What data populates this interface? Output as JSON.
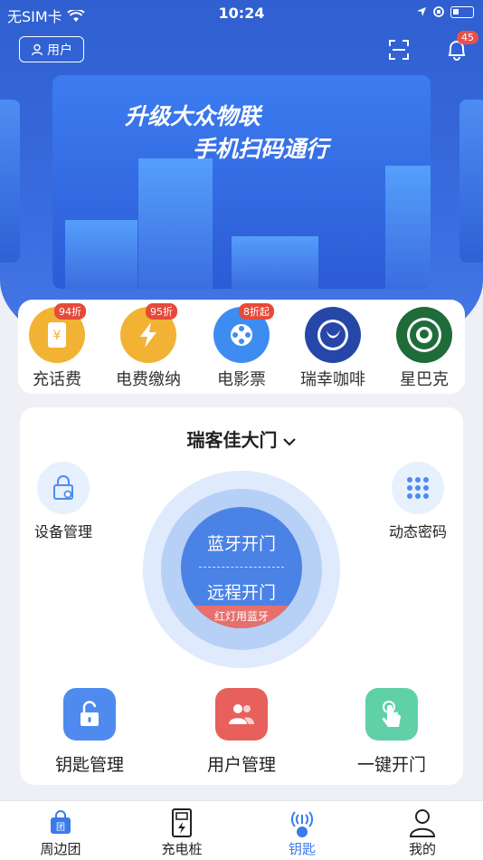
{
  "status_bar": {
    "carrier": "无SIM卡",
    "time": "10:24"
  },
  "header": {
    "user_label": "用户",
    "notification_count": "45"
  },
  "banner": {
    "line1": "升级大众物联",
    "line2": "手机扫码通行"
  },
  "services": [
    {
      "label": "充话费",
      "tag": "94折",
      "color": "#f2b233",
      "icon": "phone-bill-icon"
    },
    {
      "label": "电费缴纳",
      "tag": "95折",
      "color": "#f2b233",
      "icon": "lightning-icon"
    },
    {
      "label": "电影票",
      "tag": "8折起",
      "color": "#3f8cf0",
      "icon": "film-reel-icon"
    },
    {
      "label": "瑞幸咖啡",
      "tag": "",
      "color": "#2647a8",
      "icon": "luckin-logo-icon"
    },
    {
      "label": "星巴克",
      "tag": "",
      "color": "#1f6b3a",
      "icon": "starbucks-logo-icon"
    }
  ],
  "door": {
    "title": "瑞客佳大门",
    "device_manage": "设备管理",
    "dynamic_password": "动态密码",
    "bluetooth_open": "蓝牙开门",
    "remote_open": "远程开门",
    "hint": "红灯用蓝牙"
  },
  "actions": [
    {
      "label": "钥匙管理",
      "color": "#4f8bef",
      "icon": "unlock-icon"
    },
    {
      "label": "用户管理",
      "color": "#e8605c",
      "icon": "users-icon"
    },
    {
      "label": "一键开门",
      "color": "#5fd0a8",
      "icon": "touch-icon"
    }
  ],
  "tabs": [
    {
      "label": "周边团",
      "icon": "shopping-bag-icon"
    },
    {
      "label": "充电桩",
      "icon": "charger-icon"
    },
    {
      "label": "钥匙",
      "icon": "signal-key-icon",
      "active": true
    },
    {
      "label": "我的",
      "icon": "person-icon"
    }
  ]
}
